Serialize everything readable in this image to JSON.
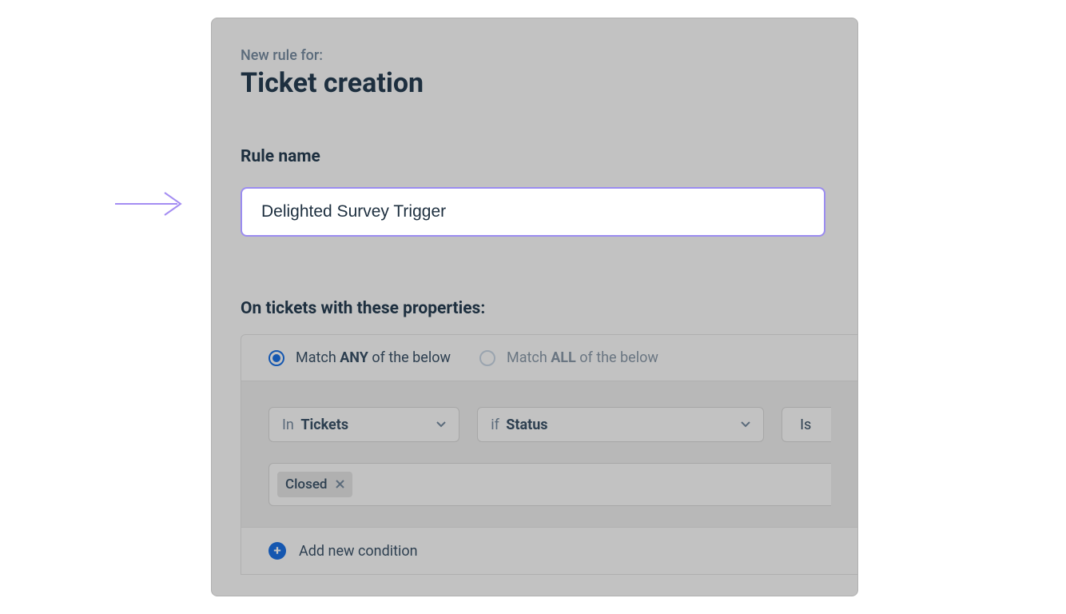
{
  "header": {
    "subtitle": "New rule for:",
    "title": "Ticket creation"
  },
  "ruleName": {
    "label": "Rule name",
    "value": "Delighted Survey Trigger"
  },
  "properties": {
    "label": "On tickets with these properties:",
    "matchAny": {
      "pre": "Match ",
      "bold": "ANY",
      "post": " of the below"
    },
    "matchAll": {
      "pre": "Match ",
      "bold": "ALL",
      "post": " of the below"
    }
  },
  "condition": {
    "in": {
      "pre": "In ",
      "bold": "Tickets"
    },
    "if": {
      "pre": "if ",
      "bold": "Status"
    },
    "is": {
      "label": "Is"
    },
    "tag": "Closed"
  },
  "addCondition": "Add new condition"
}
